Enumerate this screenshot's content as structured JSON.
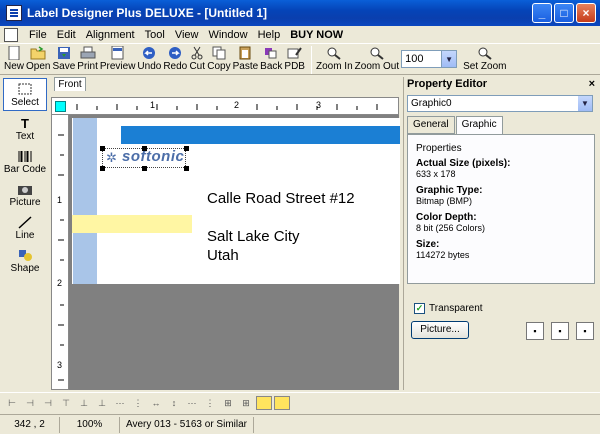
{
  "window": {
    "title": "Label Designer Plus DELUXE - [Untitled 1]",
    "controls": [
      "_",
      "□",
      "×"
    ]
  },
  "menu": [
    "File",
    "Edit",
    "Alignment",
    "Tool",
    "View",
    "Window",
    "Help",
    "BUY NOW"
  ],
  "toolbar": {
    "buttons": [
      "New",
      "Open",
      "Save",
      "Print",
      "Preview",
      "Undo",
      "Redo",
      "Cut",
      "Copy",
      "Paste",
      "Back",
      "PDB"
    ],
    "zoom_in": "Zoom In",
    "zoom_out": "Zoom Out",
    "zoom_value": "100",
    "set_zoom": "Set Zoom"
  },
  "palette": [
    "Select",
    "Text",
    "Bar Code",
    "Picture",
    "Line",
    "Shape"
  ],
  "canvas": {
    "tab": "Front",
    "ruler_h": [
      "1",
      "2",
      "3"
    ],
    "ruler_v": [
      "1",
      "2",
      "3"
    ],
    "logo_text": "softonic",
    "address": [
      "Calle Road Street #12",
      "Salt Lake City",
      "Utah"
    ]
  },
  "property_editor": {
    "title": "Property Editor",
    "close": "×",
    "selected_object": "Graphic0",
    "tabs": [
      "General",
      "Graphic"
    ],
    "group_label": "Properties",
    "fields": [
      {
        "key": "Actual Size (pixels):",
        "value": "633 x 178"
      },
      {
        "key": "Graphic Type:",
        "value": "Bitmap (BMP)"
      },
      {
        "key": "Color Depth:",
        "value": "8 bit (256 Colors)"
      },
      {
        "key": "Size:",
        "value": "114272 bytes"
      }
    ],
    "transparent_label": "Transparent",
    "picture_button": "Picture..."
  },
  "status": {
    "coords": "342 , 2",
    "zoom": "100%",
    "label_type": "Avery 013 - 5163 or Similar"
  }
}
